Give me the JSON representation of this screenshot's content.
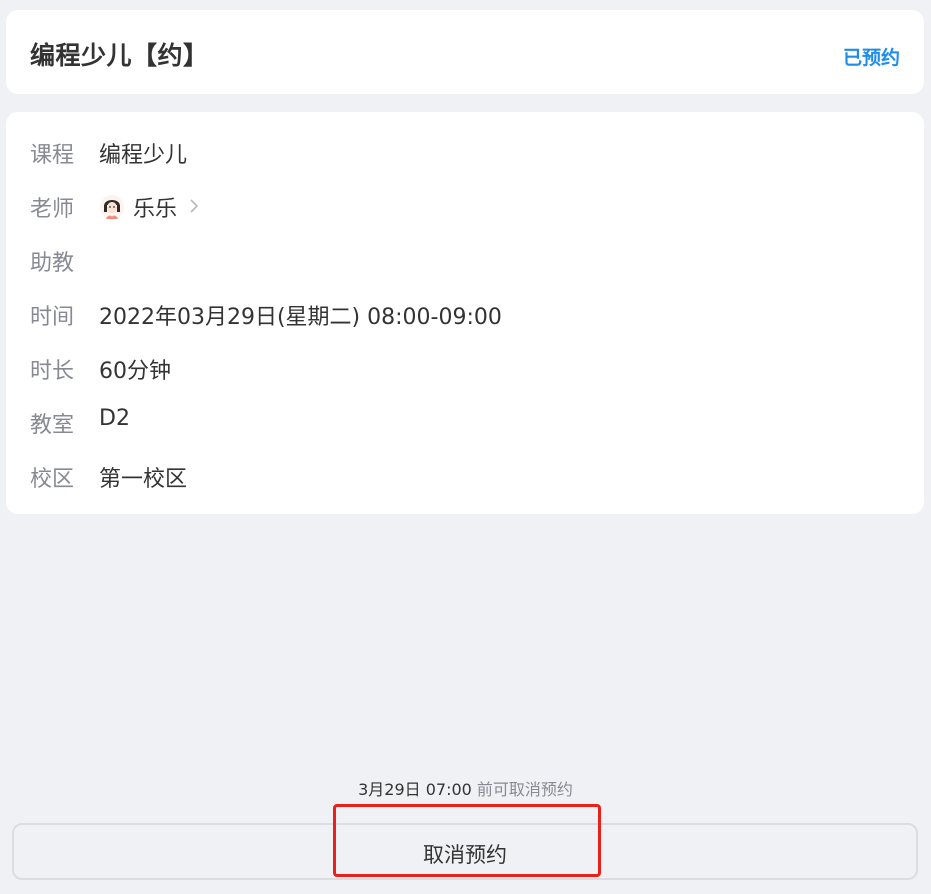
{
  "header": {
    "title": "编程少儿【约】",
    "status": "已预约"
  },
  "details": {
    "course": {
      "label": "课程",
      "value": "编程少儿"
    },
    "teacher": {
      "label": "老师",
      "value": "乐乐"
    },
    "assistant": {
      "label": "助教",
      "value": ""
    },
    "time": {
      "label": "时间",
      "value": "2022年03月29日(星期二) 08:00-09:00"
    },
    "duration": {
      "label": "时长",
      "value": "60分钟"
    },
    "classroom": {
      "label": "教室",
      "value": "D2"
    },
    "campus": {
      "label": "校区",
      "value": "第一校区"
    }
  },
  "footer": {
    "deadline_time": "3月29日 07:00",
    "deadline_text": " 前可取消预约",
    "cancel_label": "取消预约"
  },
  "colors": {
    "accent": "#1e8de8",
    "highlight": "#e8221a",
    "background": "#f0f1f5"
  },
  "icons": {
    "avatar": "teacher-avatar-icon",
    "chevron": "chevron-right-icon"
  }
}
